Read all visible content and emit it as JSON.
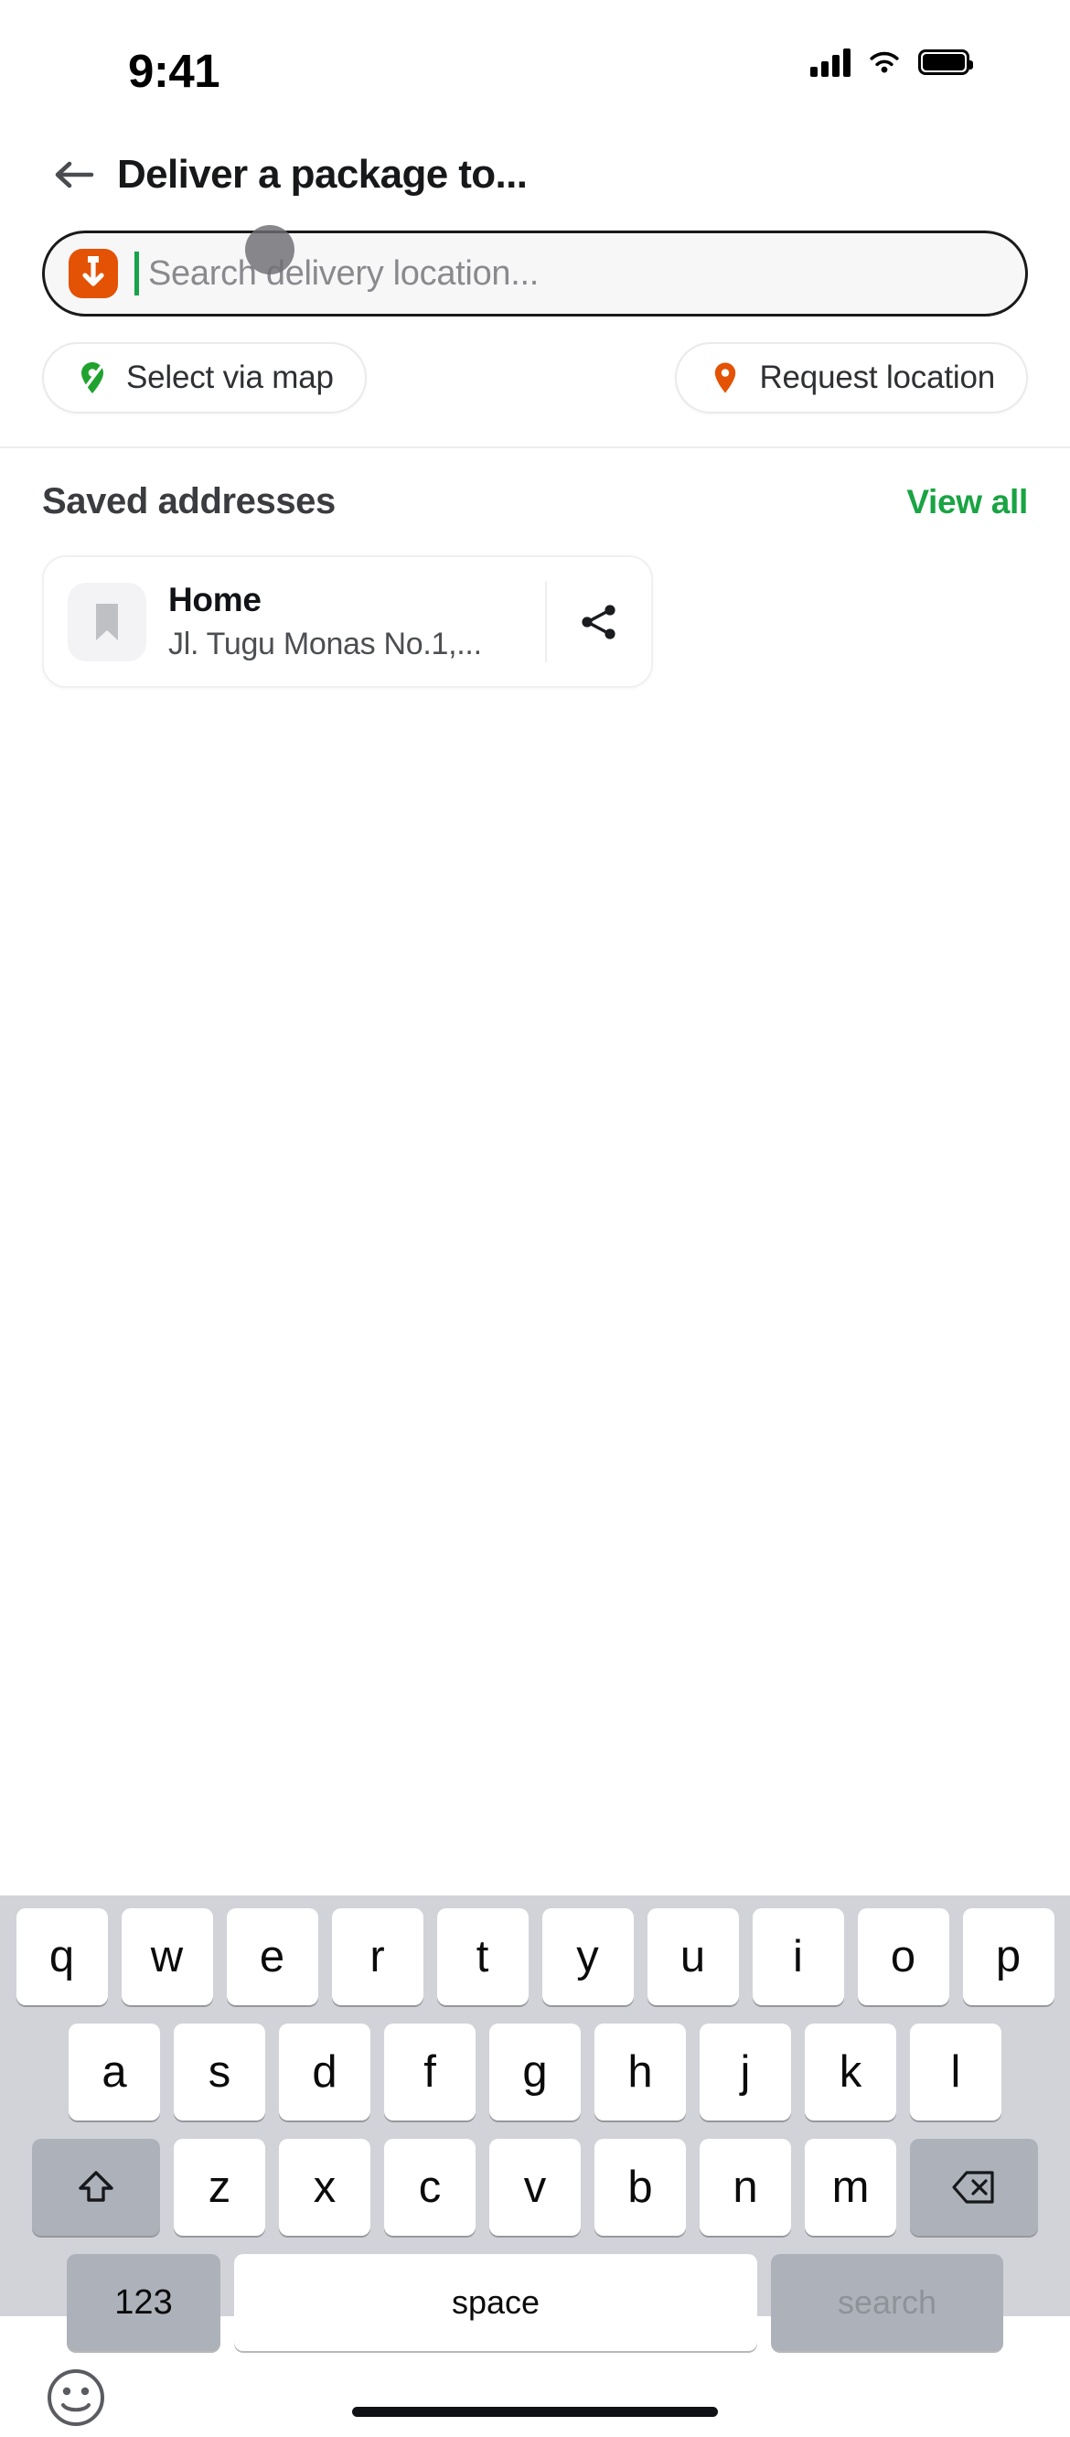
{
  "status_bar": {
    "time": "9:41",
    "signal_icon": "cellular-signal-icon",
    "wifi_icon": "wifi-icon",
    "battery_icon": "battery-icon"
  },
  "header": {
    "back_icon": "back-arrow-icon",
    "title": "Deliver a package to..."
  },
  "search": {
    "leading_icon": "package-drop-icon",
    "placeholder": "Search delivery location...",
    "value": "",
    "caret_color": "#17A34A",
    "icon_color": "#E35205"
  },
  "quick_actions": [
    {
      "label": "Select via map",
      "icon": "map-pin-icon",
      "color": "#1FA32E"
    },
    {
      "label": "Request location",
      "icon": "location-pin-icon",
      "color": "#E35205"
    }
  ],
  "saved_addresses": {
    "title": "Saved addresses",
    "view_all_label": "View all",
    "view_all_color": "#19A443",
    "items": [
      {
        "name": "Home",
        "address": "Jl. Tugu Monas No.1,...",
        "thumb_icon": "bookmark-icon",
        "share_icon": "share-icon"
      }
    ]
  },
  "keyboard": {
    "row1": [
      "q",
      "w",
      "e",
      "r",
      "t",
      "y",
      "u",
      "i",
      "o",
      "p"
    ],
    "row2": [
      "a",
      "s",
      "d",
      "f",
      "g",
      "h",
      "j",
      "k",
      "l"
    ],
    "row3": [
      "z",
      "x",
      "c",
      "v",
      "b",
      "n",
      "m"
    ],
    "shift_icon": "shift-icon",
    "backspace_icon": "backspace-icon",
    "numbers_label": "123",
    "space_label": "space",
    "return_label": "search",
    "emoji_icon": "emoji-icon"
  }
}
